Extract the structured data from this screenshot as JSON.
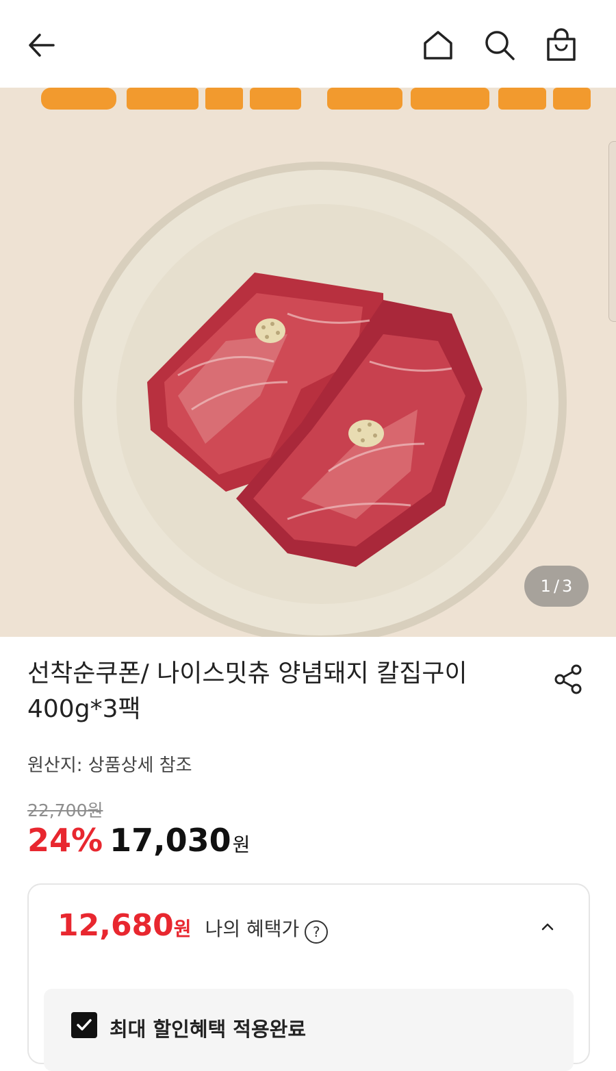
{
  "header": {
    "back_icon": "arrow-left-icon",
    "home_icon": "home-icon",
    "search_icon": "search-icon",
    "cart_icon": "shopping-bag-icon"
  },
  "gallery": {
    "current": "1",
    "separator": "/",
    "total": "3",
    "banner_text": "양념돼지 칼집구이"
  },
  "product": {
    "title": "선착순쿠폰/ 나이스밋츄 양념돼지 칼집구이 400g*3팩",
    "origin": "원산지: 상품상세 참조",
    "original_price": "22,700원",
    "discount": "24%",
    "price": "17,030",
    "currency": "원"
  },
  "benefit": {
    "price": "12,680",
    "currency": "원",
    "label": "나의 혜택가",
    "help": "?",
    "applied_label": "최대 할인혜택 적용완료"
  },
  "colors": {
    "accent_red": "#e8272f",
    "hero_bg": "#eee2d3",
    "banner_orange": "#f29a2e"
  }
}
